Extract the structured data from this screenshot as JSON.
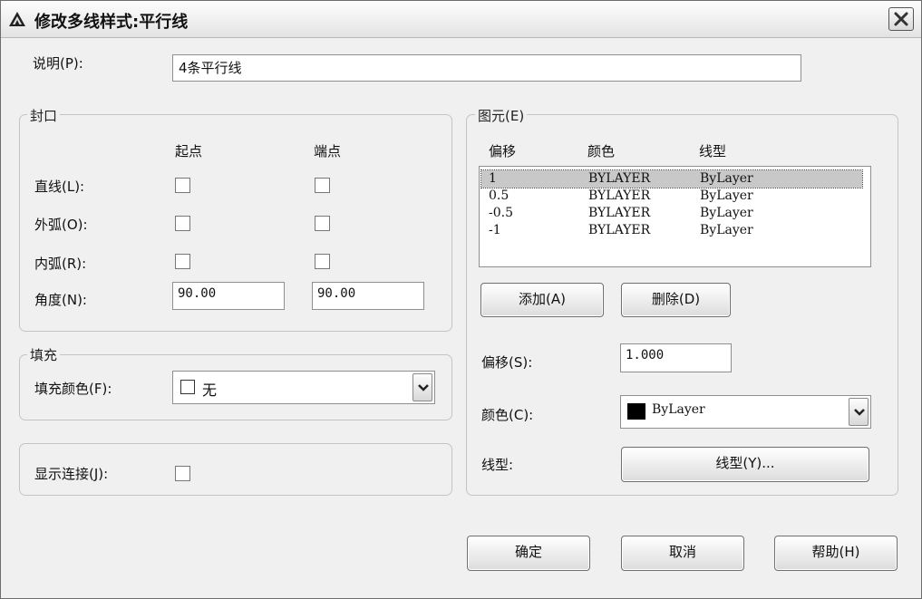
{
  "window": {
    "title": "修改多线样式:平行线"
  },
  "description": {
    "label": "说明(P):",
    "value": "4条平行线"
  },
  "caps": {
    "group_title": "封口",
    "start_header": "起点",
    "end_header": "端点",
    "line_label": "直线(L):",
    "outer_arc_label": "外弧(O):",
    "inner_arc_label": "内弧(R):",
    "angle_label": "角度(N):",
    "angle_start": "90.00",
    "angle_end": "90.00"
  },
  "fill": {
    "group_title": "填充",
    "color_label": "填充颜色(F):",
    "color_value": "无"
  },
  "display_joints": {
    "label": "显示连接(J):"
  },
  "elements": {
    "group_title": "图元(E)",
    "headers": {
      "offset": "偏移",
      "color": "颜色",
      "linetype": "线型"
    },
    "rows": [
      {
        "offset": "1",
        "color": "BYLAYER",
        "linetype": "ByLayer",
        "selected": true
      },
      {
        "offset": "0.5",
        "color": "BYLAYER",
        "linetype": "ByLayer",
        "selected": false
      },
      {
        "offset": "-0.5",
        "color": "BYLAYER",
        "linetype": "ByLayer",
        "selected": false
      },
      {
        "offset": "-1",
        "color": "BYLAYER",
        "linetype": "ByLayer",
        "selected": false
      }
    ],
    "add_button": "添加(A)",
    "delete_button": "删除(D)",
    "offset_label": "偏移(S):",
    "offset_value": "1.000",
    "color_label": "颜色(C):",
    "color_value": "ByLayer",
    "color_swatch": "#000000",
    "linetype_label": "线型:",
    "linetype_button": "线型(Y)..."
  },
  "footer": {
    "ok": "确定",
    "cancel": "取消",
    "help": "帮助(H)"
  },
  "icons": {
    "app": "autocad-triangle-icon",
    "close": "close-icon",
    "dropdown": "chevron-down-icon"
  }
}
